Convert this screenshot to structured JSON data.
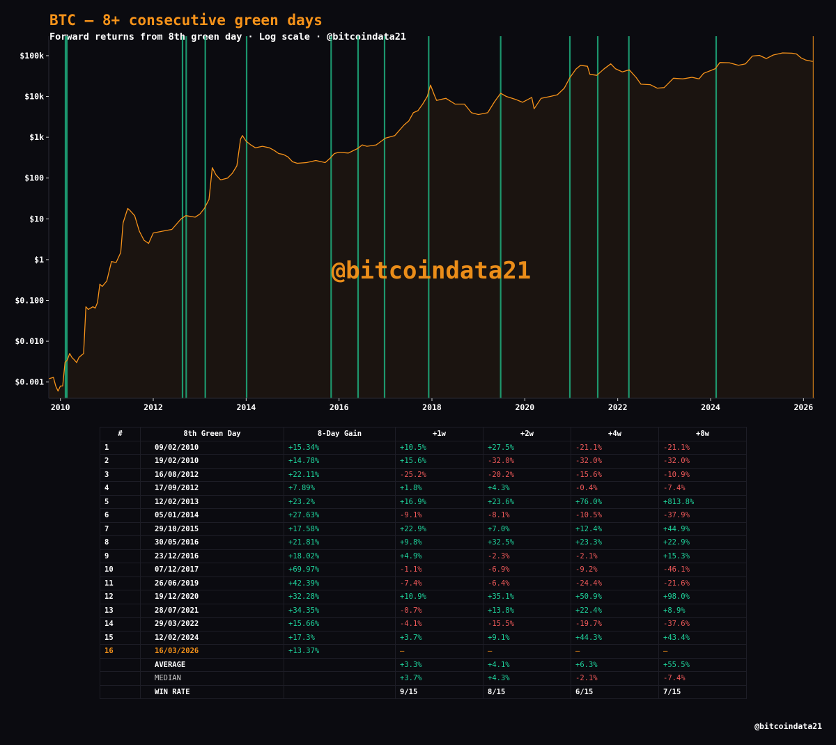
{
  "header": {
    "title": "BTC — 8+ consecutive green days",
    "subtitle": "Forward returns from 8th green day · Log scale · @bitcoindata21"
  },
  "watermark": "@bitcoindata21",
  "footer": "@bitcoindata21",
  "colors": {
    "background": "#0b0b10",
    "price_line": "#f7931a",
    "event_line": "#1fae7e",
    "positive": "#1fd39c",
    "negative": "#f05a5a"
  },
  "chart_data": {
    "type": "line",
    "title": "BTC — 8+ consecutive green days",
    "yscale": "log",
    "ylim": [
      0.0004,
      300000
    ],
    "xlim": [
      2009.75,
      2026.25
    ],
    "yticks": [
      {
        "value": 0.001,
        "label": "$0.001"
      },
      {
        "value": 0.01,
        "label": "$0.010"
      },
      {
        "value": 0.1,
        "label": "$0.100"
      },
      {
        "value": 1,
        "label": "$1"
      },
      {
        "value": 10,
        "label": "$10"
      },
      {
        "value": 100,
        "label": "$100"
      },
      {
        "value": 1000,
        "label": "$1k"
      },
      {
        "value": 10000,
        "label": "$10k"
      },
      {
        "value": 100000,
        "label": "$100k"
      }
    ],
    "xticks": [
      {
        "value": 2010,
        "label": "2010"
      },
      {
        "value": 2012,
        "label": "2012"
      },
      {
        "value": 2014,
        "label": "2014"
      },
      {
        "value": 2016,
        "label": "2016"
      },
      {
        "value": 2018,
        "label": "2018"
      },
      {
        "value": 2020,
        "label": "2020"
      },
      {
        "value": 2022,
        "label": "2022"
      },
      {
        "value": 2024,
        "label": "2024"
      },
      {
        "value": 2026,
        "label": "2026"
      }
    ],
    "series": [
      {
        "points": [
          [
            2009.75,
            0.0012
          ],
          [
            2009.85,
            0.0013
          ],
          [
            2009.9,
            0.0008
          ],
          [
            2009.95,
            0.0006
          ],
          [
            2010.0,
            0.0008
          ],
          [
            2010.05,
            0.0008
          ],
          [
            2010.1,
            0.003
          ],
          [
            2010.15,
            0.0035
          ],
          [
            2010.2,
            0.005
          ],
          [
            2010.25,
            0.004
          ],
          [
            2010.3,
            0.0035
          ],
          [
            2010.35,
            0.003
          ],
          [
            2010.4,
            0.004
          ],
          [
            2010.45,
            0.0045
          ],
          [
            2010.5,
            0.005
          ],
          [
            2010.55,
            0.07
          ],
          [
            2010.6,
            0.06
          ],
          [
            2010.65,
            0.065
          ],
          [
            2010.7,
            0.07
          ],
          [
            2010.75,
            0.065
          ],
          [
            2010.8,
            0.09
          ],
          [
            2010.85,
            0.25
          ],
          [
            2010.9,
            0.22
          ],
          [
            2011.0,
            0.3
          ],
          [
            2011.1,
            0.9
          ],
          [
            2011.2,
            0.85
          ],
          [
            2011.3,
            1.5
          ],
          [
            2011.35,
            8
          ],
          [
            2011.45,
            18
          ],
          [
            2011.5,
            16
          ],
          [
            2011.6,
            12
          ],
          [
            2011.7,
            5
          ],
          [
            2011.8,
            3
          ],
          [
            2011.9,
            2.5
          ],
          [
            2012.0,
            4.5
          ],
          [
            2012.2,
            5
          ],
          [
            2012.4,
            5.5
          ],
          [
            2012.6,
            10
          ],
          [
            2012.7,
            12
          ],
          [
            2012.9,
            11
          ],
          [
            2013.0,
            13
          ],
          [
            2013.1,
            18
          ],
          [
            2013.2,
            30
          ],
          [
            2013.27,
            180
          ],
          [
            2013.35,
            120
          ],
          [
            2013.45,
            90
          ],
          [
            2013.6,
            100
          ],
          [
            2013.7,
            130
          ],
          [
            2013.8,
            200
          ],
          [
            2013.88,
            900
          ],
          [
            2013.92,
            1100
          ],
          [
            2014.0,
            800
          ],
          [
            2014.1,
            650
          ],
          [
            2014.2,
            550
          ],
          [
            2014.35,
            600
          ],
          [
            2014.5,
            550
          ],
          [
            2014.6,
            480
          ],
          [
            2014.7,
            400
          ],
          [
            2014.8,
            380
          ],
          [
            2014.9,
            330
          ],
          [
            2015.0,
            250
          ],
          [
            2015.1,
            230
          ],
          [
            2015.3,
            240
          ],
          [
            2015.5,
            270
          ],
          [
            2015.7,
            240
          ],
          [
            2015.8,
            300
          ],
          [
            2015.9,
            400
          ],
          [
            2016.0,
            430
          ],
          [
            2016.2,
            410
          ],
          [
            2016.4,
            530
          ],
          [
            2016.5,
            650
          ],
          [
            2016.6,
            600
          ],
          [
            2016.8,
            650
          ],
          [
            2017.0,
            950
          ],
          [
            2017.2,
            1100
          ],
          [
            2017.4,
            2000
          ],
          [
            2017.5,
            2500
          ],
          [
            2017.6,
            4000
          ],
          [
            2017.7,
            4500
          ],
          [
            2017.8,
            6500
          ],
          [
            2017.9,
            10000
          ],
          [
            2017.97,
            19000
          ],
          [
            2018.05,
            11000
          ],
          [
            2018.1,
            8000
          ],
          [
            2018.3,
            9000
          ],
          [
            2018.5,
            6500
          ],
          [
            2018.7,
            6500
          ],
          [
            2018.85,
            4000
          ],
          [
            2019.0,
            3600
          ],
          [
            2019.2,
            4000
          ],
          [
            2019.35,
            7500
          ],
          [
            2019.48,
            12000
          ],
          [
            2019.6,
            10000
          ],
          [
            2019.8,
            8500
          ],
          [
            2019.95,
            7200
          ],
          [
            2020.15,
            9500
          ],
          [
            2020.2,
            5000
          ],
          [
            2020.35,
            9000
          ],
          [
            2020.55,
            10000
          ],
          [
            2020.7,
            11000
          ],
          [
            2020.85,
            16000
          ],
          [
            2020.97,
            29000
          ],
          [
            2021.1,
            47000
          ],
          [
            2021.2,
            58000
          ],
          [
            2021.35,
            55000
          ],
          [
            2021.4,
            35000
          ],
          [
            2021.55,
            33000
          ],
          [
            2021.7,
            47000
          ],
          [
            2021.85,
            63000
          ],
          [
            2021.95,
            48000
          ],
          [
            2022.1,
            40000
          ],
          [
            2022.25,
            45000
          ],
          [
            2022.4,
            29000
          ],
          [
            2022.5,
            20000
          ],
          [
            2022.7,
            19500
          ],
          [
            2022.85,
            16000
          ],
          [
            2023.0,
            16500
          ],
          [
            2023.2,
            28000
          ],
          [
            2023.4,
            27000
          ],
          [
            2023.6,
            29500
          ],
          [
            2023.75,
            27000
          ],
          [
            2023.85,
            37000
          ],
          [
            2024.0,
            43000
          ],
          [
            2024.1,
            48000
          ],
          [
            2024.2,
            68000
          ],
          [
            2024.4,
            67000
          ],
          [
            2024.6,
            58000
          ],
          [
            2024.75,
            63000
          ],
          [
            2024.9,
            98000
          ],
          [
            2025.05,
            102000
          ],
          [
            2025.2,
            85000
          ],
          [
            2025.35,
            104000
          ],
          [
            2025.55,
            117000
          ],
          [
            2025.75,
            115000
          ],
          [
            2025.85,
            110000
          ],
          [
            2025.95,
            88000
          ],
          [
            2026.05,
            78000
          ],
          [
            2026.2,
            72000
          ]
        ]
      }
    ],
    "events": [
      2010.11,
      2010.14,
      2012.63,
      2012.71,
      2013.12,
      2014.01,
      2015.83,
      2016.41,
      2016.98,
      2017.93,
      2019.48,
      2020.97,
      2021.57,
      2022.24,
      2024.12,
      2026.21
    ]
  },
  "table": {
    "columns": [
      "#",
      "8th Green Day",
      "8-Day Gain",
      "+1w",
      "+2w",
      "+4w",
      "+8w"
    ],
    "rows": [
      {
        "n": "1",
        "date": "09/02/2010",
        "gain": "+15.34%",
        "w1": "+10.5%",
        "w2": "+27.5%",
        "w4": "-21.1%",
        "w8": "-21.1%"
      },
      {
        "n": "2",
        "date": "19/02/2010",
        "gain": "+14.78%",
        "w1": "+15.6%",
        "w2": "-32.0%",
        "w4": "-32.0%",
        "w8": "-32.0%"
      },
      {
        "n": "3",
        "date": "16/08/2012",
        "gain": "+22.11%",
        "w1": "-25.2%",
        "w2": "-20.2%",
        "w4": "-15.6%",
        "w8": "-10.9%"
      },
      {
        "n": "4",
        "date": "17/09/2012",
        "gain": "+7.89%",
        "w1": "+1.8%",
        "w2": "+4.3%",
        "w4": "-0.4%",
        "w8": "-7.4%"
      },
      {
        "n": "5",
        "date": "12/02/2013",
        "gain": "+23.2%",
        "w1": "+16.9%",
        "w2": "+23.6%",
        "w4": "+76.0%",
        "w8": "+813.8%"
      },
      {
        "n": "6",
        "date": "05/01/2014",
        "gain": "+27.63%",
        "w1": "-9.1%",
        "w2": "-8.1%",
        "w4": "-10.5%",
        "w8": "-37.9%"
      },
      {
        "n": "7",
        "date": "29/10/2015",
        "gain": "+17.58%",
        "w1": "+22.9%",
        "w2": "+7.0%",
        "w4": "+12.4%",
        "w8": "+44.9%"
      },
      {
        "n": "8",
        "date": "30/05/2016",
        "gain": "+21.81%",
        "w1": "+9.8%",
        "w2": "+32.5%",
        "w4": "+23.3%",
        "w8": "+22.9%"
      },
      {
        "n": "9",
        "date": "23/12/2016",
        "gain": "+18.02%",
        "w1": "+4.9%",
        "w2": "-2.3%",
        "w4": "-2.1%",
        "w8": "+15.3%"
      },
      {
        "n": "10",
        "date": "07/12/2017",
        "gain": "+69.97%",
        "w1": "-1.1%",
        "w2": "-6.9%",
        "w4": "-9.2%",
        "w8": "-46.1%"
      },
      {
        "n": "11",
        "date": "26/06/2019",
        "gain": "+42.39%",
        "w1": "-7.4%",
        "w2": "-6.4%",
        "w4": "-24.4%",
        "w8": "-21.6%"
      },
      {
        "n": "12",
        "date": "19/12/2020",
        "gain": "+32.28%",
        "w1": "+10.9%",
        "w2": "+35.1%",
        "w4": "+50.9%",
        "w8": "+98.0%"
      },
      {
        "n": "13",
        "date": "28/07/2021",
        "gain": "+34.35%",
        "w1": "-0.7%",
        "w2": "+13.8%",
        "w4": "+22.4%",
        "w8": "+8.9%"
      },
      {
        "n": "14",
        "date": "29/03/2022",
        "gain": "+15.66%",
        "w1": "-4.1%",
        "w2": "-15.5%",
        "w4": "-19.7%",
        "w8": "-37.6%"
      },
      {
        "n": "15",
        "date": "12/02/2024",
        "gain": "+17.3%",
        "w1": "+3.7%",
        "w2": "+9.1%",
        "w4": "+44.3%",
        "w8": "+43.4%"
      },
      {
        "n": "16",
        "date": "16/03/2026",
        "gain": "+13.37%",
        "w1": "—",
        "w2": "—",
        "w4": "—",
        "w8": "—"
      }
    ],
    "summary": [
      {
        "label": "AVERAGE",
        "w1": "+3.3%",
        "w2": "+4.1%",
        "w4": "+6.3%",
        "w8": "+55.5%"
      },
      {
        "label": "MEDIAN",
        "w1": "+3.7%",
        "w2": "+4.3%",
        "w4": "-2.1%",
        "w8": "-7.4%"
      },
      {
        "label": "WIN RATE",
        "w1": "9/15",
        "w2": "8/15",
        "w4": "6/15",
        "w8": "7/15"
      }
    ]
  }
}
